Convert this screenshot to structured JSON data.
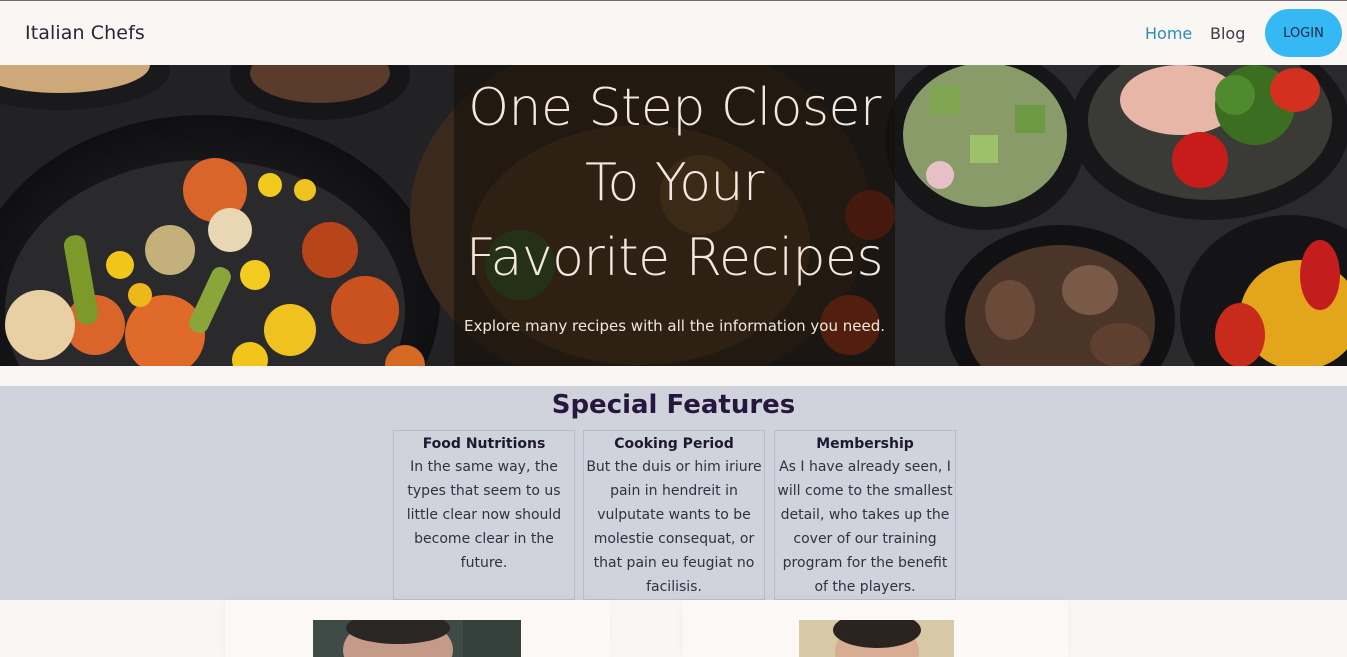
{
  "navbar": {
    "brand": "Italian Chefs",
    "links": [
      {
        "label": "Home",
        "active": true
      },
      {
        "label": "Blog",
        "active": false
      }
    ],
    "login_label": "LOGIN"
  },
  "hero": {
    "title_lines": [
      "One Step Closer",
      "To Your",
      "Favorite Recipes"
    ],
    "subtitle": "Explore many recipes with all the information you need."
  },
  "features": {
    "title": "Special Features",
    "cards": [
      {
        "title": "Food Nutritions",
        "lines": [
          "In the same way, the",
          "types that seem to us",
          "little clear now should",
          "become clear in the",
          "future."
        ]
      },
      {
        "title": "Cooking Period",
        "lines": [
          "But the duis or him iriure",
          "pain in hendreit in",
          "vulputate wants to be",
          "molestie consequat, or",
          "that pain eu feugiat no",
          "facilisis."
        ]
      },
      {
        "title": "Membership",
        "lines": [
          "As I have already seen, I",
          "will come to the smallest",
          "detail, who takes up the",
          "cover of our training",
          "program for the benefit",
          "of the players."
        ]
      }
    ]
  },
  "colors": {
    "accent_link": "#2a8fb0",
    "login_button": "#35b8f4",
    "features_bg": "#d0d2dc",
    "page_bg": "#faf6f3"
  }
}
